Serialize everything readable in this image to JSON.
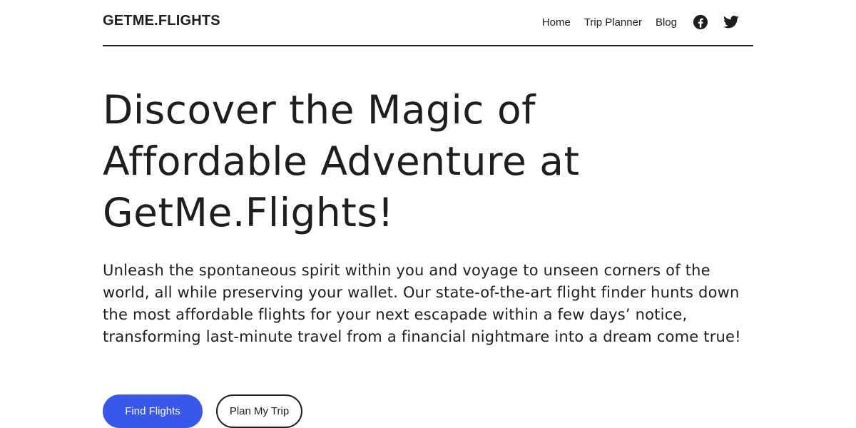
{
  "site": {
    "brand": "GETME.FLIGHTS"
  },
  "nav": {
    "items": [
      {
        "label": "Home"
      },
      {
        "label": "Trip Planner"
      },
      {
        "label": "Blog"
      }
    ],
    "social": [
      {
        "icon": "facebook-icon"
      },
      {
        "icon": "twitter-icon"
      }
    ]
  },
  "hero": {
    "title_lines": [
      "Discover the Magic of",
      "Affordable Adventure at",
      "GetMe.Flights!"
    ],
    "description": "Unleash the spontaneous spirit within you and voyage to unseen corners of the world, all while preserving your wallet. Our state-of-the-art flight finder hunts down the most affordable flights for your next escapade within a few days’ notice, transforming last-minute travel from a financial nightmare into a dream come true!",
    "primary_button": "Find Flights",
    "secondary_button": "Plan My Trip"
  },
  "colors": {
    "accent": "#3858e9",
    "text": "#1e1e1e",
    "background": "#ffffff"
  }
}
